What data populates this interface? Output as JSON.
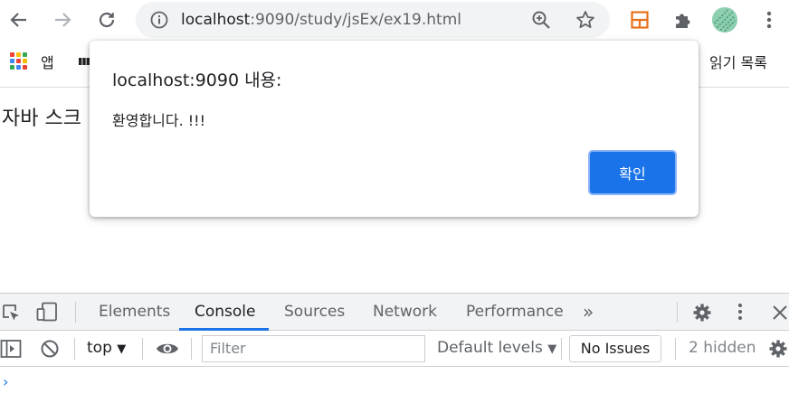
{
  "browser": {
    "url_host": "localhost",
    "url_rest": ":9090/study/jsEx/ex19.html",
    "bookmarks": {
      "apps_label": "앱",
      "reading_list": "읽기 목록"
    }
  },
  "page": {
    "heading": "자바 스크"
  },
  "alert": {
    "title": "localhost:9090 내용:",
    "message": "환영합니다. !!!",
    "ok_label": "확인"
  },
  "devtools": {
    "tabs": [
      "Elements",
      "Console",
      "Sources",
      "Network",
      "Performance"
    ],
    "active_tab": "Console",
    "more_tabs": "»",
    "context": "top",
    "filter_placeholder": "Filter",
    "levels": "Default levels",
    "issues": "No Issues",
    "hidden": "2 hidden",
    "prompt": "›"
  },
  "colors": {
    "accent": "#1a73e8",
    "toolbar_bg": "#f1f3f4"
  }
}
